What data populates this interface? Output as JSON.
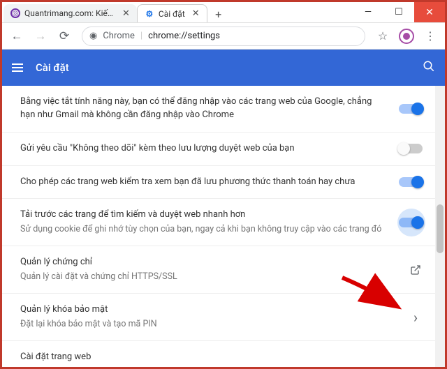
{
  "window": {
    "tabs": [
      {
        "title": "Quantrimang.com: Kiến Thức"
      },
      {
        "title": "Cài đặt"
      }
    ]
  },
  "addressbar": {
    "scheme_label": "Chrome",
    "url_path": "chrome://settings"
  },
  "appbar": {
    "title": "Cài đặt"
  },
  "settings_rows": [
    {
      "title": "Bằng việc tắt tính năng này, bạn có thể đăng nhập vào các trang web của Google, chẳng hạn như Gmail mà không cần đăng nhập vào Chrome",
      "sub": "",
      "type": "toggle",
      "state": "on"
    },
    {
      "title": "Gửi yêu cầu \"Không theo dõi\" kèm theo lưu lượng duyệt web của bạn",
      "sub": "",
      "type": "toggle",
      "state": "off"
    },
    {
      "title": "Cho phép các trang web kiểm tra xem bạn đã lưu phương thức thanh toán hay chưa",
      "sub": "",
      "type": "toggle",
      "state": "on"
    },
    {
      "title": "Tải trước các trang để tìm kiếm và duyệt web nhanh hơn",
      "sub": "Sử dụng cookie để ghi nhớ tùy chọn của bạn, ngay cả khi bạn không truy cập vào các trang đó",
      "type": "toggle",
      "state": "on",
      "highlight": true
    },
    {
      "title": "Quản lý chứng chỉ",
      "sub": "Quản lý cài đặt và chứng chỉ HTTPS/SSL",
      "type": "external"
    },
    {
      "title": "Quản lý khóa bảo mật",
      "sub": "Đặt lại khóa bảo mật và tạo mã PIN",
      "type": "chevron"
    },
    {
      "title": "Cài đặt trang web",
      "sub": "",
      "type": "none"
    }
  ]
}
